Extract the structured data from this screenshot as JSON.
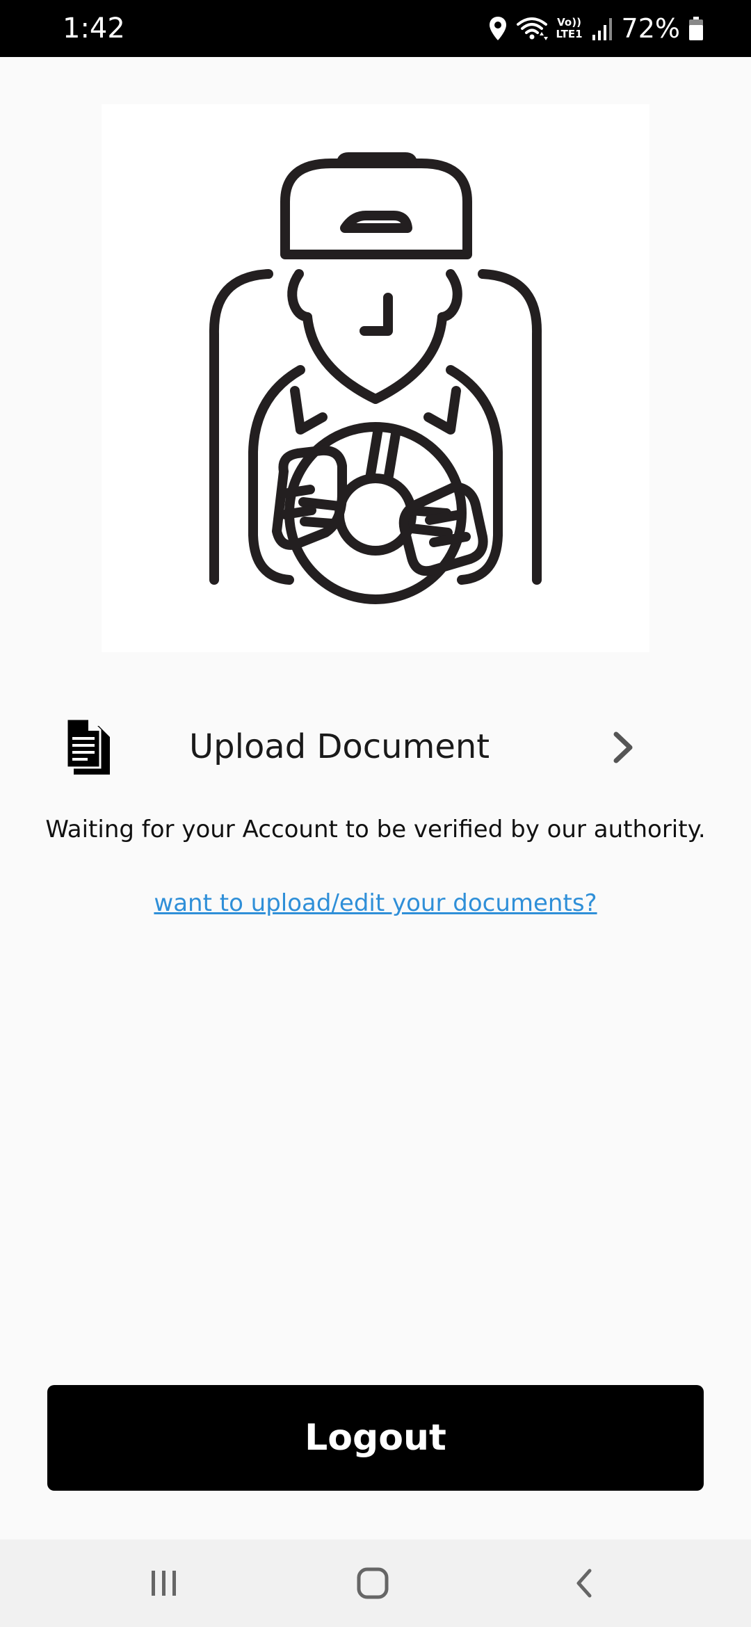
{
  "status_bar": {
    "time": "1:42",
    "network_label_top": "Vo))",
    "network_label_bottom": "LTE1",
    "battery": "72%",
    "icons": [
      "location-icon",
      "wifi-icon",
      "signal-icon",
      "battery-icon"
    ]
  },
  "hero": {
    "icon": "driver-steering-wheel-illustration"
  },
  "upload": {
    "label": "Upload Document",
    "icon": "document-icon",
    "chevron": "chevron-right-icon"
  },
  "status_message": "Waiting for your Account to be verified by our authority.",
  "edit_link": "want to upload/edit your documents?",
  "logout_label": "Logout",
  "nav": {
    "recents_icon": "recent-apps-icon",
    "home_icon": "home-icon",
    "back_icon": "back-icon"
  },
  "colors": {
    "status_bar_bg": "#000000",
    "page_bg": "#fafafa",
    "link": "#2f8fd8",
    "button_bg": "#000000",
    "button_text": "#ffffff",
    "nav_bg": "#f1f1f1"
  }
}
